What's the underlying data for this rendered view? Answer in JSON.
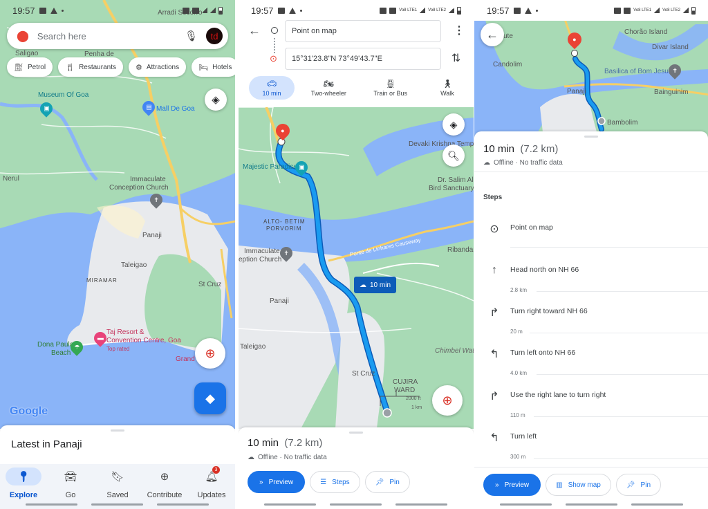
{
  "status_bar": {
    "time": "19:57",
    "network_1": "Vo8 LTE1",
    "network_2": "Vo8 LTE2"
  },
  "panel_explore": {
    "search": {
      "placeholder": "Search here",
      "avatar_initials": "td"
    },
    "chips": [
      {
        "label": "Petrol",
        "icon": "petrol-icon"
      },
      {
        "label": "Restaurants",
        "icon": "restaurant-icon"
      },
      {
        "label": "Attractions",
        "icon": "attraction-icon"
      },
      {
        "label": "Hotels",
        "icon": "hotel-icon"
      }
    ],
    "map_labels": {
      "arradi": "Arradi Socorro",
      "penha": "Penha de",
      "saligao": "Saligao",
      "museum": "Museum Of Goa",
      "mall": "Mall De Goa",
      "nerul": "Nerul",
      "church": "Immaculate Conception Church",
      "church_l1": "Immaculate",
      "church_l2": "Conception Church",
      "panaji": "Panaji",
      "taleigao": "Taleigao",
      "miramar": "MIRAMAR",
      "stcruz": "St Cruz",
      "taj_l1": "Taj Resort &",
      "taj_l2": "Convention Centre, Goa",
      "taj_tag": "Top rated",
      "dona_l1": "Dona Paula",
      "dona_l2": "Beach",
      "grand": "Grand"
    },
    "google_logo": "Google",
    "sheet_title": "Latest in Panaji",
    "nav": [
      {
        "label": "Explore",
        "icon": "explore-pin-icon",
        "active": true
      },
      {
        "label": "Go",
        "icon": "commute-icon"
      },
      {
        "label": "Saved",
        "icon": "bookmark-icon"
      },
      {
        "label": "Contribute",
        "icon": "add-circle-icon"
      },
      {
        "label": "Updates",
        "icon": "bell-icon",
        "badge": "3"
      }
    ]
  },
  "panel_directions": {
    "origin": "Point on map",
    "destination": "15°31'23.8\"N 73°49'43.7\"E",
    "modes": [
      {
        "label": "10 min",
        "icon": "car-icon",
        "active": true
      },
      {
        "label": "Two-wheeler",
        "icon": "motorbike-icon"
      },
      {
        "label": "Train or Bus",
        "icon": "train-icon"
      },
      {
        "label": "Walk",
        "icon": "walk-icon"
      }
    ],
    "map_labels": {
      "majestic": "Majestic Paradise",
      "devaki": "Devaki Krishna Temple",
      "salim_l1": "Dr. Salim Ali",
      "salim_l2": "Bird Sanctuary",
      "alto_l1": "ALTO- BETIM",
      "alto_l2": "PORVORIM",
      "church_l1": "Immaculate",
      "church_l2": "eption Church",
      "causeway": "Ponte de Linhares Causeway",
      "ribandar": "Ribandar",
      "panaji": "Panaji",
      "taleigao": "Taleigao",
      "chimbel": "Chimbel Wate",
      "stcruz": "St Cruz",
      "cujira_l1": "CUJIRA",
      "cujira_l2": "WARD",
      "scale_ft": "2000 ft",
      "scale_km": "1 km"
    },
    "route_badge": "10 min",
    "summary": {
      "duration": "10 min",
      "distance": "(7.2 km)",
      "traffic": "Offline · No traffic data"
    },
    "buttons": {
      "preview": "Preview",
      "steps": "Steps",
      "pin": "Pin"
    }
  },
  "panel_steps": {
    "map_labels": {
      "chorao": "Chorão Island",
      "divar": "Divar Island",
      "ute": "ute",
      "candolim": "Candolim",
      "basilica": "Basilica of Bom Jesus",
      "panaji": "Panaji",
      "bainguinim": "Bainguinim",
      "bambolim": "Bambolim"
    },
    "summary": {
      "duration": "10 min",
      "distance": "(7.2 km)",
      "traffic": "Offline · No traffic data"
    },
    "steps_header": "Steps",
    "steps": [
      {
        "text": "Point on map",
        "distance": "",
        "icon": "location-pin-icon"
      },
      {
        "text": "Head north on NH 66",
        "distance": "2.8 km",
        "icon": "arrow-up-icon"
      },
      {
        "text": "Turn right toward NH 66",
        "distance": "20 m",
        "icon": "turn-right-icon"
      },
      {
        "text": "Turn left onto NH 66",
        "distance": "4.0 km",
        "icon": "turn-left-icon"
      },
      {
        "text": "Use the right lane to turn right",
        "distance": "110 m",
        "icon": "turn-right-icon"
      },
      {
        "text": "Turn left",
        "distance": "300 m",
        "icon": "turn-left-icon"
      }
    ],
    "buttons": {
      "preview": "Preview",
      "show_map": "Show map",
      "pin": "Pin"
    }
  },
  "colors": {
    "accent": "#1a73e8",
    "route": "#1a9bf0",
    "land": "#a8dab5",
    "water": "#8ab4f8",
    "pin": "#ea4335"
  }
}
